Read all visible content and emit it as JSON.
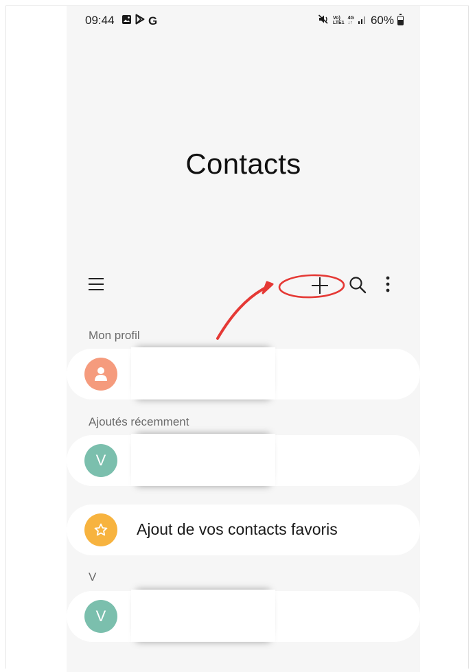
{
  "status_bar": {
    "time": "09:44",
    "left_icons": [
      "gallery-icon",
      "play-store-icon",
      "google-g-icon"
    ],
    "google_letter": "G",
    "network_top": "Vo)",
    "network_bottom": "LTE1",
    "network_type": "4G",
    "battery": "60%",
    "battery_level": 0.6
  },
  "app": {
    "title": "Contacts"
  },
  "toolbar": {
    "icons": [
      "menu-icon",
      "add-icon",
      "search-icon",
      "more-options-icon"
    ]
  },
  "sections": {
    "profile": {
      "label": "Mon profil",
      "avatar_color": "#f59b7d"
    },
    "recent": {
      "label": "Ajoutés récemment",
      "avatar_letter": "V",
      "avatar_color": "#7bbfad"
    },
    "favorites": {
      "label": "Ajout de vos contacts favoris",
      "avatar_color": "#f7b33f"
    },
    "v_group": {
      "label": "V",
      "avatar_letter": "V",
      "avatar_color": "#7bbfad"
    }
  },
  "annotation": {
    "color": "#e53935"
  }
}
